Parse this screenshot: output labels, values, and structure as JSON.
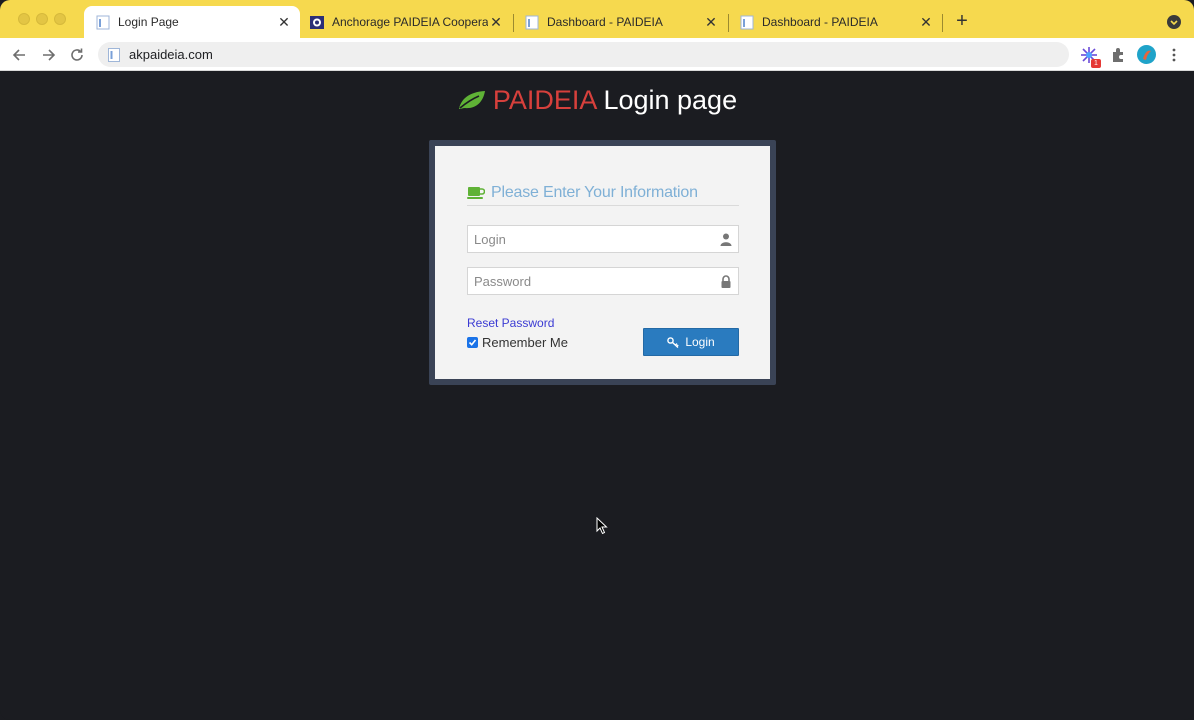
{
  "browser": {
    "tabs": [
      {
        "title": "Login Page",
        "active": true
      },
      {
        "title": "Anchorage PAIDEIA Cooperativ",
        "active": false
      },
      {
        "title": "Dashboard - PAIDEIA",
        "active": false
      },
      {
        "title": "Dashboard - PAIDEIA",
        "active": false
      }
    ],
    "close_glyph": "✕",
    "new_tab_glyph": "+",
    "url": "akpaideia.com",
    "extension_badge": "1",
    "colors": {
      "tabbar": "#f6d94e",
      "omnibox": "#efefef"
    }
  },
  "page": {
    "brand": "PAIDEIA",
    "heading_rest": " Login page",
    "form": {
      "heading": "Please Enter Your Information",
      "login_placeholder": "Login",
      "password_placeholder": "Password",
      "reset_link": "Reset Password",
      "remember_label": "Remember Me",
      "remember_checked": true,
      "submit_label": "Login"
    },
    "colors": {
      "background": "#1b1c21",
      "brand": "#d7403c",
      "leaf": "#5fb236",
      "panel_border": "#3a4356",
      "heading": "#7fb0d6",
      "button": "#2a7bbf",
      "link": "#3b3bd3"
    },
    "icons": {
      "heading": "leaf-icon",
      "form_heading": "coffee-cup-icon",
      "login_field": "user-icon",
      "password_field": "lock-icon",
      "submit": "key-icon"
    }
  }
}
